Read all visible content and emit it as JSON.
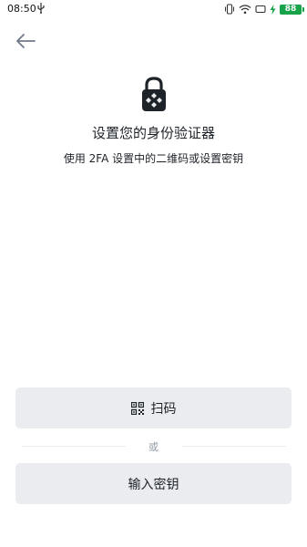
{
  "status_bar": {
    "time": "08:50",
    "battery_level": "88",
    "icons": [
      "usb-icon",
      "vibrate-icon",
      "wifi-icon",
      "screen-icon",
      "charging-icon",
      "battery-icon"
    ],
    "battery_color": "#16a34a"
  },
  "nav": {
    "back_icon": "arrow-left-icon"
  },
  "header": {
    "illustration": "lock-icon",
    "title": "设置您的身份验证器",
    "subtitle": "使用 2FA 设置中的二维码或设置密钥"
  },
  "actions": {
    "scan_label": "扫码",
    "scan_icon": "qr-code-icon",
    "divider_label": "或",
    "enter_key_label": "输入密钥"
  },
  "colors": {
    "button_bg": "#eaecef",
    "text": "#1e2329",
    "muted": "#929aa5"
  }
}
